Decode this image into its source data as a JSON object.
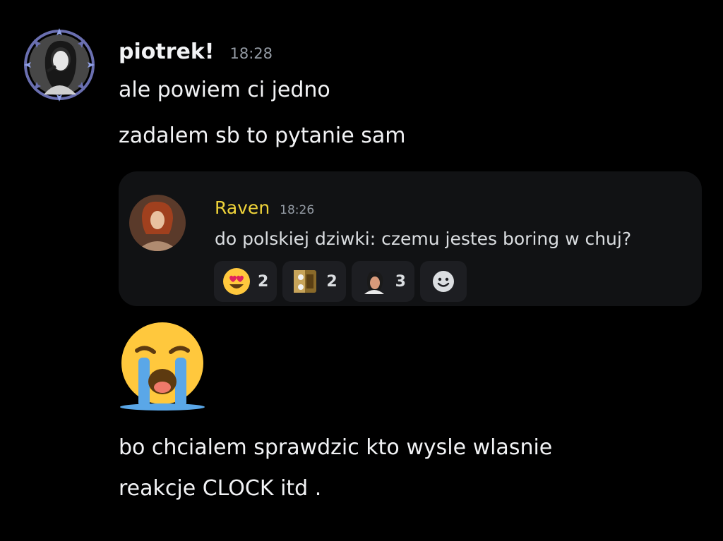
{
  "message": {
    "username": "piotrek!",
    "timestamp": "18:28",
    "lines": [
      "ale powiem ci jedno",
      "zadalem sb to pytanie sam"
    ],
    "after_emoji_lines": [
      "bo chcialem sprawdzic kto wysle wlasnie",
      "reakcje CLOCK itd ."
    ],
    "big_emoji": "loudly-crying-face-icon"
  },
  "embed": {
    "username": "Raven",
    "timestamp": "18:26",
    "text": "do polskiej dziwki: czemu jestes boring w chuj?",
    "reactions": [
      {
        "icon": "heart-eyes-face-icon",
        "count": "2"
      },
      {
        "icon": "custom-emoji-icon",
        "count": "2"
      },
      {
        "icon": "custom-face-emoji-icon",
        "count": "3"
      }
    ],
    "add_reaction_icon": "smiley-add-reaction-icon"
  },
  "colors": {
    "background": "#000000",
    "embed_bg": "#111214",
    "reaction_bg": "#1d1e22",
    "embed_name": "#f0d43a",
    "muted": "#949ba4",
    "text": "#f2f3f5"
  }
}
